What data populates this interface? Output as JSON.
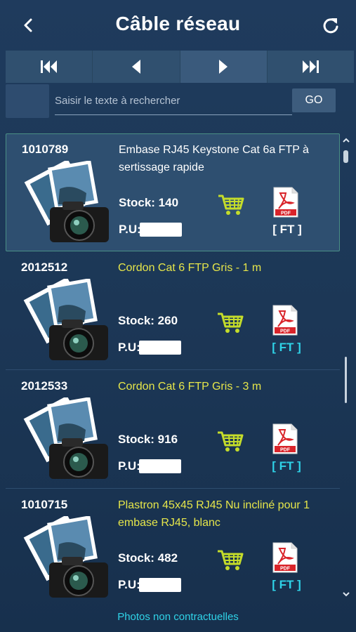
{
  "header": {
    "title": "Câble réseau",
    "back_icon": "chevron-left-icon",
    "refresh_icon": "refresh-icon"
  },
  "pager": {
    "buttons": [
      "first-page-icon",
      "previous-page-icon",
      "next-page-icon",
      "last-page-icon"
    ]
  },
  "search": {
    "placeholder": "Saisir le texte à rechercher",
    "value": "",
    "go_label": "GO"
  },
  "items": [
    {
      "ref": "1010789",
      "description": "Embase RJ45 Keystone Cat 6a FTP à sertissage rapide",
      "stock": "Stock: 140",
      "pu_label": "P.U:",
      "ft_label": "[ FT ]",
      "desc_color": "white",
      "ft_color": "white",
      "selected": true
    },
    {
      "ref": "2012512",
      "description": "Cordon Cat 6 FTP Gris - 1 m",
      "stock": "Stock: 260",
      "pu_label": "P.U:",
      "ft_label": "[ FT ]",
      "desc_color": "yellow",
      "ft_color": "cyan",
      "selected": false
    },
    {
      "ref": "2012533",
      "description": "Cordon Cat 6 FTP Gris - 3 m",
      "stock": "Stock: 916",
      "pu_label": "P.U:",
      "ft_label": "[ FT ]",
      "desc_color": "yellow",
      "ft_color": "cyan",
      "selected": false
    },
    {
      "ref": "1010715",
      "description": "Plastron 45x45 RJ45 Nu incliné pour 1 embase RJ45, blanc",
      "stock": "Stock: 482",
      "pu_label": "P.U:",
      "ft_label": "[ FT ]",
      "desc_color": "yellow",
      "ft_color": "cyan",
      "selected": false
    }
  ],
  "footer": {
    "note": "Photos non contractuelles"
  },
  "colors": {
    "background": "#1f3b5d",
    "accent_yellow": "#e6e64a",
    "accent_cyan": "#2fd3e8",
    "cart_green": "#c4dc2a",
    "pdf_red": "#d9242a"
  }
}
